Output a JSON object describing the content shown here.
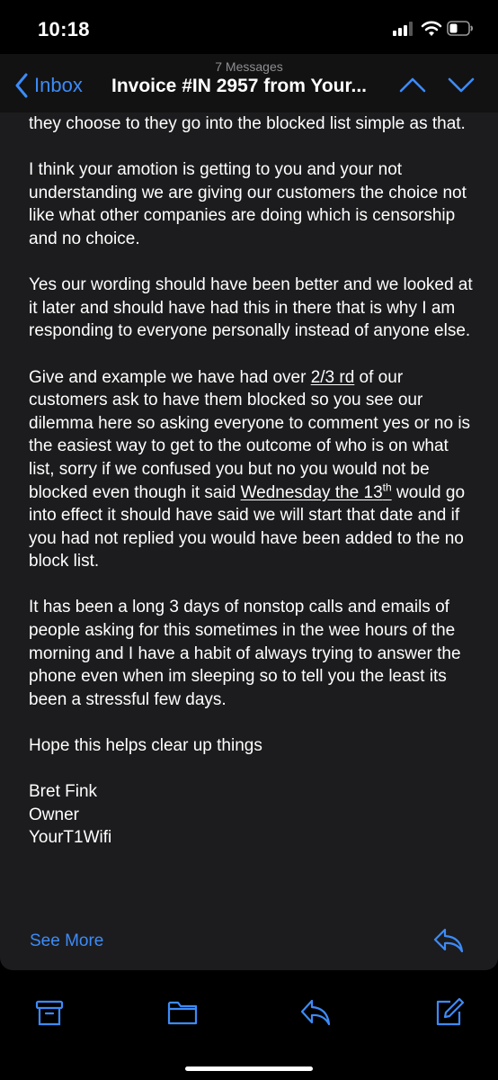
{
  "status_bar": {
    "time": "10:18"
  },
  "nav": {
    "back_label": "Inbox",
    "message_count": "7 Messages",
    "subject": "Invoice #IN 2957 from Your..."
  },
  "message": {
    "p1": "they choose to they go into the blocked list  simple as that.",
    "p2": "I think your amotion is getting to you and your not understanding we are giving our customers the choice not like what other companies are doing which is censorship and no choice.",
    "p3": "Yes our wording should have been better and we looked at it later and should have had this in there that is why I am responding to everyone personally instead of anyone else.",
    "p4": {
      "a": "Give and example we have had over ",
      "b": "2/3 rd",
      "c": " of our customers ask to have them blocked so you see our dilemma here so asking everyone to comment yes or no is the easiest way to get to the outcome of who is on what list, sorry if we confused you but no you would not be blocked even though it said ",
      "d": "Wednesday the 13",
      "sup": "th",
      "e": " would go into effect it should have said we will start that date and if you had not replied you would have been added to the no block list."
    },
    "p5": "It has been a long 3 days of nonstop calls  and emails of people asking for this sometimes in the wee hours of the morning and I have a habit of always trying to answer the phone even when im sleeping so to tell you the least its been a stressful few days.",
    "p6": "Hope this helps clear up things",
    "sig_name": "Bret Fink",
    "sig_title": "Owner",
    "sig_company": "YourT1Wifi",
    "see_more": "See More"
  },
  "colors": {
    "accent": "#3d8bf7",
    "background": "#000000",
    "card": "#1c1c1e"
  },
  "icons": [
    "cellular-signal-icon",
    "wifi-icon",
    "battery-icon",
    "chevron-left-icon",
    "chevron-up-icon",
    "chevron-down-icon",
    "reply-icon",
    "archive-icon",
    "folder-icon",
    "compose-icon"
  ]
}
